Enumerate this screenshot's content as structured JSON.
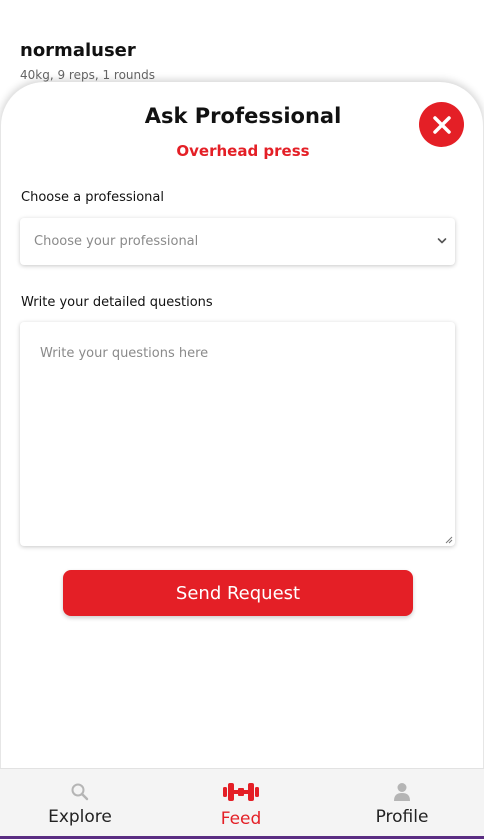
{
  "feed_card": {
    "username": "normaluser",
    "stats": "40kg, 9 reps, 1 rounds"
  },
  "modal": {
    "title": "Ask Professional",
    "exercise": "Overhead press",
    "close_icon": "close-icon",
    "professional_label": "Choose a professional",
    "professional_placeholder": "Choose your professional",
    "questions_label": "Write your detailed questions",
    "questions_placeholder": "Write your questions here",
    "send_label": "Send Request"
  },
  "nav": {
    "items": [
      {
        "label": "Explore",
        "icon": "search-icon",
        "active": false
      },
      {
        "label": "Feed",
        "icon": "dumbbell-icon",
        "active": true
      },
      {
        "label": "Profile",
        "icon": "person-icon",
        "active": false
      }
    ]
  },
  "colors": {
    "accent": "#e41f26",
    "nav_background": "#f4f4f4",
    "placeholder": "#8a8a8a"
  }
}
